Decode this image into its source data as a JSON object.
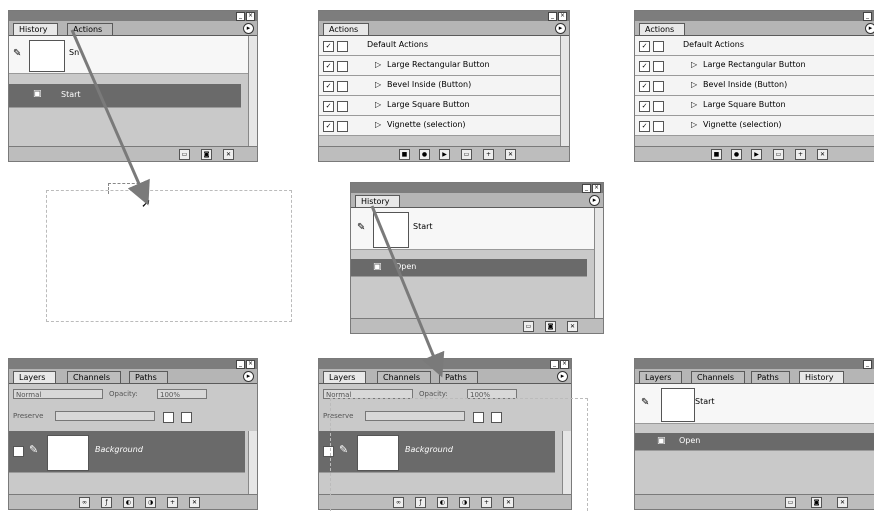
{
  "panels": {
    "history_top": {
      "tabs": [
        "History",
        "Actions"
      ],
      "snapshot_label": "Sn",
      "state_label": "Start"
    },
    "actions_a": {
      "tab": "Actions",
      "set_name": "Default Actions",
      "items": [
        "Large Rectangular Button",
        "Bevel Inside (Button)",
        "Large Square Button",
        "Vignette (selection)"
      ]
    },
    "actions_b": {
      "tab": "Actions",
      "set_name": "Default Actions",
      "items": [
        "Large Rectangular Button",
        "Bevel Inside (Button)",
        "Large Square Button",
        "Vignette (selection)"
      ]
    },
    "history_mid": {
      "tabs": [
        "History"
      ],
      "snapshot_label": "Start",
      "state_label": "Open"
    },
    "layers_left": {
      "tabs": [
        "Layers",
        "Channels",
        "Paths"
      ],
      "blend_mode": "Normal",
      "opacity_label": "Opacity:",
      "opacity_value": "100%",
      "preserve_label": "Preserve",
      "layer_name": "Background"
    },
    "layers_mid": {
      "tabs": [
        "Layers",
        "Channels",
        "Paths"
      ],
      "blend_mode": "Normal",
      "opacity_label": "Opacity:",
      "opacity_value": "100%",
      "preserve_label": "Preserve",
      "layer_name": "Background"
    },
    "combined_right": {
      "tabs": [
        "Layers",
        "Channels",
        "Paths",
        "History"
      ],
      "snapshot_label": "Start",
      "state_label": "Open"
    }
  },
  "colors": {
    "panel_bg": "#c9c9c9",
    "selected_row": "#6a6a6a",
    "arrow": "#7a7a7a"
  },
  "icons": [
    "brush-icon",
    "history-brush-icon",
    "checkmark-icon",
    "triangle-right-icon",
    "trash-icon",
    "new-document-icon",
    "camera-icon",
    "panel-menu-icon"
  ]
}
